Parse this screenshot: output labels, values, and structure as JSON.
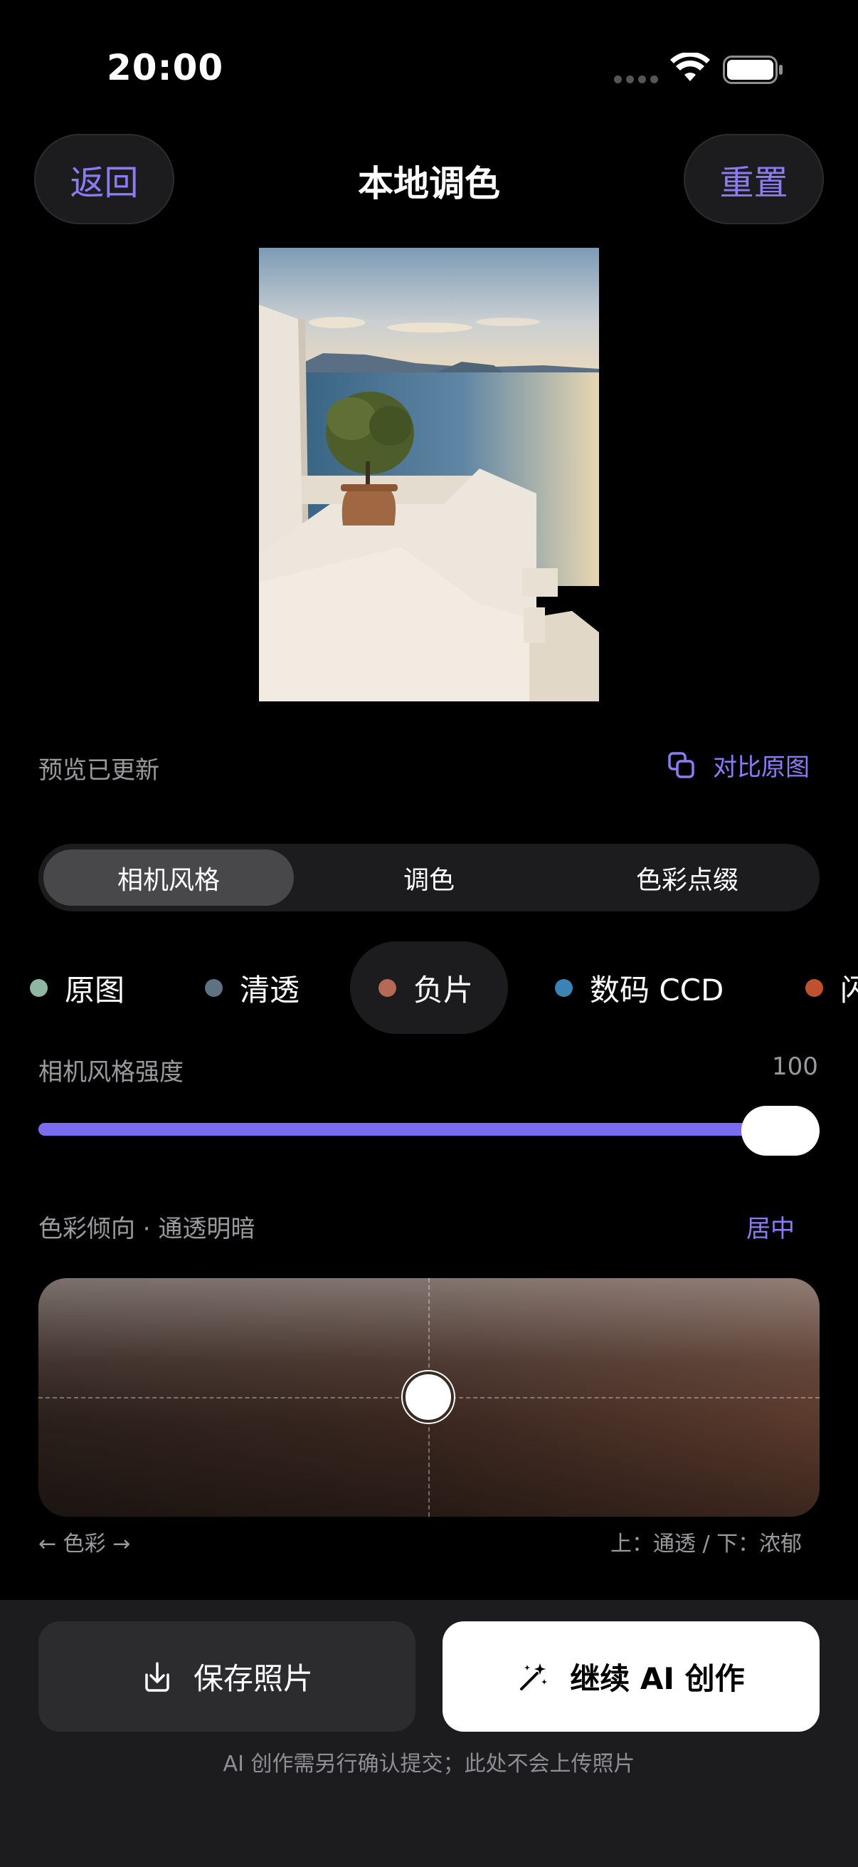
{
  "status_bar": {
    "time": "20:00"
  },
  "header": {
    "back_label": "返回",
    "title": "本地调色",
    "reset_label": "重置"
  },
  "preview": {
    "status": "预览已更新",
    "compare_label": "对比原图"
  },
  "tabs": [
    {
      "label": "相机风格",
      "active": true
    },
    {
      "label": "调色",
      "active": false
    },
    {
      "label": "色彩点缀",
      "active": false
    }
  ],
  "styles": [
    {
      "label": "原图",
      "color": "#8fb5a3"
    },
    {
      "label": "清透",
      "color": "#5f7282"
    },
    {
      "label": "负片",
      "color": "#b56a55",
      "active": true
    },
    {
      "label": "数码 CCD",
      "color": "#3b82b5"
    },
    {
      "label": "闪",
      "color": "#c0512e"
    }
  ],
  "strength": {
    "label": "相机风格强度",
    "value": "100",
    "fraction": 1.0
  },
  "color_pad": {
    "label": "色彩倾向 · 通透明暗",
    "center_label": "居中",
    "x_caption": "← 色彩 →",
    "y_caption": "上：通透 / 下：浓郁"
  },
  "actions": {
    "save_label": "保存照片",
    "ai_label": "继续 AI 创作",
    "footnote": "AI 创作需另行确认提交；此处不会上传照片"
  },
  "colors": {
    "accent": "#8b7cf6",
    "slider": "#7c6cf0"
  }
}
